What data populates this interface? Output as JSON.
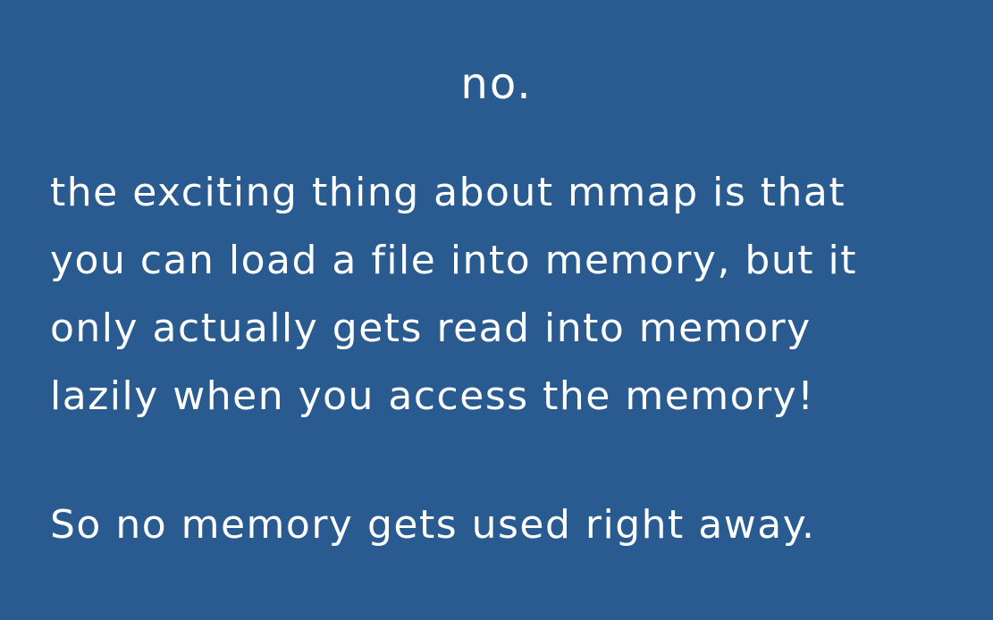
{
  "slide": {
    "title": "no.",
    "paragraph_lines": [
      "the exciting thing about mmap is that",
      "you can load a file into memory, but it",
      "only actually gets read into memory",
      "lazily when you access the memory!"
    ],
    "closing": "So no memory gets used right away."
  },
  "colors": {
    "background": "#295b91",
    "text": "#ffffff"
  }
}
